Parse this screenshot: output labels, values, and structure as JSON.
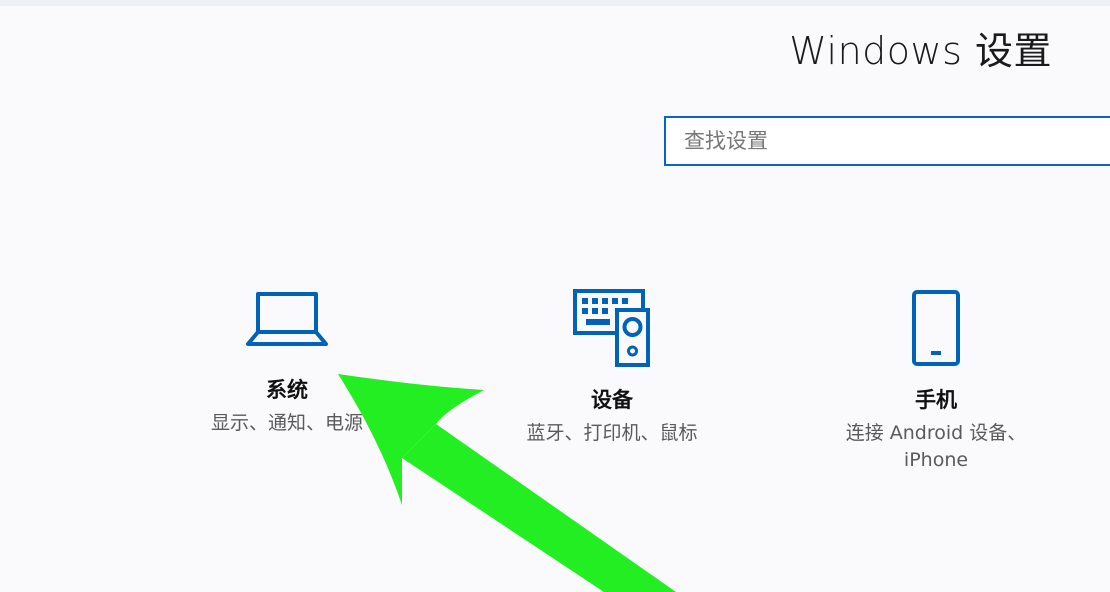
{
  "window": {
    "title": "Windows 设置"
  },
  "search": {
    "placeholder": "查找设置",
    "value": ""
  },
  "tiles": [
    {
      "icon": "laptop-icon",
      "title": "系统",
      "description": "显示、通知、电源"
    },
    {
      "icon": "keyboard-speaker-icon",
      "title": "设备",
      "description": "蓝牙、打印机、鼠标"
    },
    {
      "icon": "phone-icon",
      "title": "手机",
      "description_lines": [
        "连接 Android 设备、",
        "iPhone"
      ]
    }
  ],
  "colors": {
    "accent": "#0a64c8",
    "icon": "#0063b8",
    "annotation_arrow": "#22ee22",
    "background": "#fafafc"
  }
}
